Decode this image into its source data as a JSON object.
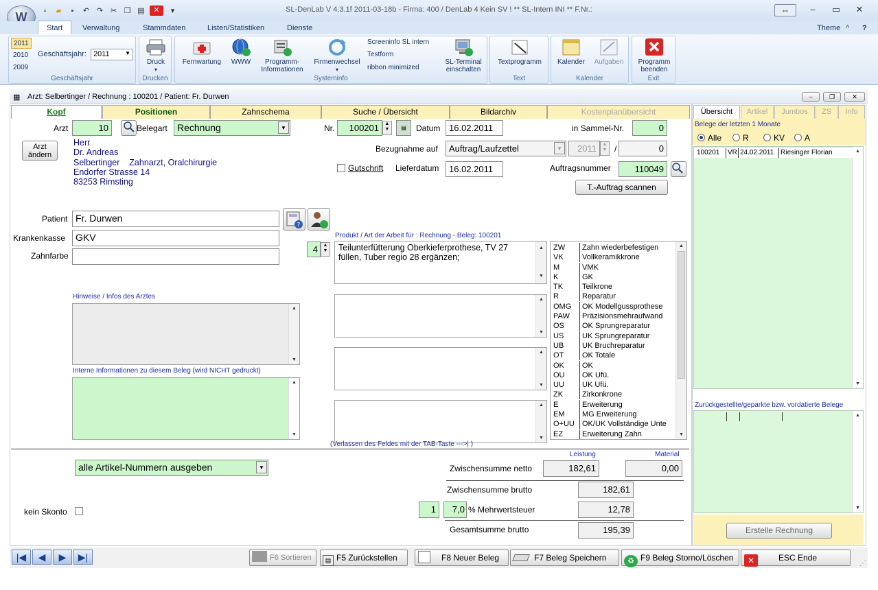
{
  "window": {
    "title": "SL-DenLab V 4.3.1f 2011-03-18b - Firma: 400 / DenLab 4 Kein SV ! ** SL-Intern INI **  F.Nr.:",
    "theme": "Theme",
    "help": "?"
  },
  "ribbon": {
    "tabs": [
      "Start",
      "Verwaltung",
      "Stammdaten",
      "Listen/Statistiken",
      "Dienste"
    ],
    "years": [
      "2011",
      "2010",
      "2009"
    ],
    "fiscal_year_label": "Geschäftsjahr:",
    "fiscal_year_value": "2011",
    "groups": {
      "geschaeftsjahr": "Geschäftsjahr",
      "drucken": "Drucken",
      "systeminfo": "Systeminfo",
      "text": "Text",
      "kalender": "Kalender",
      "exit": "Exit"
    },
    "buttons": {
      "druck": "Druck",
      "fernwartung": "Fernwartung",
      "www": "WWW",
      "programm_info_1": "Programm-",
      "programm_info_2": "Informationen",
      "firmenwechsel": "Firmenwechsel",
      "screeninfo": "Screeninfo SL intern",
      "testform": "Testform",
      "ribbon_min": "ribbon minimized",
      "sl_terminal_1": "SL-Terminal",
      "sl_terminal_2": "einschalten",
      "textprogramm": "Textprogramm",
      "kalender": "Kalender",
      "aufgaben": "Aufgaben",
      "programm_beenden_1": "Programm",
      "programm_beenden_2": "beenden"
    }
  },
  "subheader": "Arzt: Selbertinger  / Rechnung : 100201 / Patient: Fr. Durwen",
  "form_tabs": [
    "Kopf",
    "Positionen",
    "Zahnschema",
    "Suche / Übersicht",
    "Bildarchiv",
    "Kostenplanübersicht"
  ],
  "kopf": {
    "arzt_label": "Arzt",
    "arzt_value": "10",
    "arzt_aendern_1": "Arzt",
    "arzt_aendern_2": "ändern",
    "belegart_label": "Belegart",
    "belegart_value": "Rechnung",
    "address": [
      "Herr",
      "Dr. Andreas",
      "Selbertinger    Zahnarzt, Oralchirurgie",
      "Endorfer Strasse 14",
      "83253 Rimsting"
    ],
    "nr_label": "Nr.",
    "nr_value": "100201",
    "datum_label": "Datum",
    "datum_value": "16.02.2011",
    "sammel_label": "in Sammel-Nr.",
    "sammel_value": "0",
    "bezug_label": "Bezugnahme auf",
    "bezug_value": "Auftrag/Laufzettel",
    "bezug_year": "2011",
    "bezug_slash": "/",
    "bezug_nr": "0",
    "gutschrift_label": "Gutschrift",
    "lieferdatum_label": "Lieferdatum",
    "lieferdatum_value": "16.02.2011",
    "auftragsnr_label": "Auftragsnummer",
    "auftragsnr_value": "110049",
    "scan_button": "T.-Auftrag scannen",
    "patient_label": "Patient",
    "patient_value": "Fr. Durwen",
    "kasse_label": "Krankenkasse",
    "kasse_value": "GKV",
    "zahnfarbe_label": "Zahnfarbe",
    "zahnfarbe_value": "",
    "hinweise_label": "Hinweise / Infos des Arztes",
    "interne_label": "Interne Informationen zu diesem Beleg (wird NICHT gedruckt)",
    "produkt_label": "Produkt / Art der Arbeit für : Rechnung - Beleg: 100201",
    "produkt_count": "4",
    "produkt_text_1": "Teilunterfütterung Oberkieferprothese, TV 27",
    "produkt_text_2": "füllen, Tuber regio 28 ergänzen;",
    "tab_hint": "(Verlassen des Feldes mit der TAB-Taste --->| )",
    "artikel_value": "alle Artikel-Nummern ausgeben",
    "skonto_label": "kein Skonto"
  },
  "codes": [
    [
      "ZW",
      "Zahn wiederbefestigen"
    ],
    [
      "VK",
      "Vollkeramikkrone"
    ],
    [
      "M",
      "VMK"
    ],
    [
      "K",
      "GK"
    ],
    [
      "TK",
      "Teilkrone"
    ],
    [
      "R",
      "Reparatur"
    ],
    [
      "OMG",
      "OK Modellgussprothese"
    ],
    [
      "PAW",
      "Präzisionsmehraufwand"
    ],
    [
      "OS",
      "OK Sprungreparatur"
    ],
    [
      "US",
      "UK Sprungreparatur"
    ],
    [
      "UB",
      "UK Bruchreparatur"
    ],
    [
      "OT",
      "OK Totale"
    ],
    [
      "OK",
      "OK"
    ],
    [
      "OU",
      "OK Ufü."
    ],
    [
      "UU",
      "UK  Ufü."
    ],
    [
      "ZK",
      "Zirkonkrone"
    ],
    [
      "E",
      "Erweiterung"
    ],
    [
      "EM",
      "MG Erweiterung"
    ],
    [
      "O+UU",
      "OK/UK Vollständige Unte"
    ],
    [
      "EZ",
      "Erweiterung Zahn"
    ]
  ],
  "totals": {
    "leistung_label": "Leistung",
    "material_label": "Material",
    "netto_label": "Zwischensumme netto",
    "netto_leistung": "182,61",
    "netto_material": "0,00",
    "brutto_label": "Zwischensumme brutto",
    "brutto_value": "182,61",
    "mwst_code": "1",
    "mwst_rate": "7,0",
    "mwst_label": "% Mehrwertsteuer",
    "mwst_value": "12,78",
    "gesamt_label": "Gesamtsumme brutto",
    "gesamt_value": "195,39"
  },
  "right_panel": {
    "tabs": [
      "Übersicht",
      "Artikel",
      "Jumbos",
      "ZS",
      "Info"
    ],
    "belege_label": "Belege der letzten 1 Monate",
    "filters": [
      "Alle",
      "R",
      "KV",
      "A"
    ],
    "row": [
      "100201",
      "VR",
      "24.02.2011",
      "Riesinger Florian"
    ],
    "parked_label": "Zurückgestellte/geparkte bzw. vordatierte Belege",
    "erstelle_button": "Erstelle Rechnung"
  },
  "bottom_bar": {
    "f6": "F6 Sortieren",
    "f5": "F5 Zurückstellen",
    "f8": "F8 Neuer Beleg",
    "f7": "F7 Beleg Speichern",
    "f9": "F9 Beleg Storno/Löschen",
    "esc": "ESC Ende"
  }
}
